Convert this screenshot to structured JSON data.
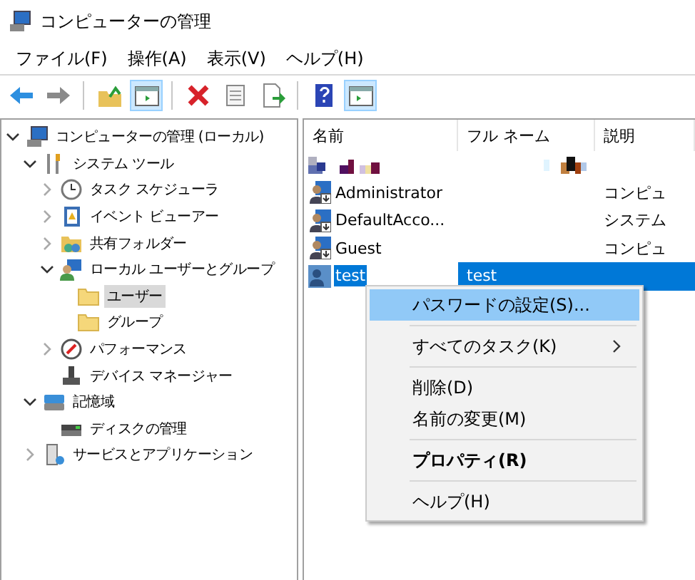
{
  "window": {
    "title": "コンピューターの管理"
  },
  "menu_bar": [
    "ファイル(F)",
    "操作(A)",
    "表示(V)",
    "ヘルプ(H)"
  ],
  "toolbar": [
    {
      "kind": "back",
      "pressed": false
    },
    {
      "kind": "forward",
      "pressed": false
    },
    {
      "kind": "separator"
    },
    {
      "kind": "up",
      "pressed": false
    },
    {
      "kind": "tree",
      "pressed": true
    },
    {
      "kind": "separator"
    },
    {
      "kind": "delete",
      "pressed": false
    },
    {
      "kind": "properties",
      "pressed": false
    },
    {
      "kind": "export",
      "pressed": false
    },
    {
      "kind": "separator"
    },
    {
      "kind": "help",
      "pressed": false
    },
    {
      "kind": "action",
      "pressed": true
    }
  ],
  "tree": [
    {
      "label": "コンピューターの管理 (ローカル)",
      "expanded": true,
      "selected": false,
      "children": [
        {
          "label": "システム ツール",
          "expanded": true,
          "selected": false,
          "children": [
            {
              "label": "タスク スケジューラ",
              "expanded": false,
              "selected": false
            },
            {
              "label": "イベント ビューアー",
              "expanded": false,
              "selected": false
            },
            {
              "label": "共有フォルダー",
              "expanded": false,
              "selected": false
            },
            {
              "label": "ローカル ユーザーとグループ",
              "expanded": true,
              "selected": false,
              "children": [
                {
                  "label": "ユーザー",
                  "selected": true
                },
                {
                  "label": "グループ",
                  "selected": false
                }
              ]
            },
            {
              "label": "パフォーマンス",
              "expanded": false,
              "selected": false
            },
            {
              "label": "デバイス マネージャー",
              "selected": false
            }
          ]
        },
        {
          "label": "記憶域",
          "expanded": true,
          "selected": false,
          "children": [
            {
              "label": "ディスクの管理",
              "selected": false
            }
          ]
        },
        {
          "label": "サービスとアプリケーション",
          "expanded": false,
          "selected": false
        }
      ]
    }
  ],
  "table": {
    "columns": [
      "名前",
      "フル ネーム",
      "説明"
    ],
    "rows": [
      {
        "kind": "redacted"
      },
      {
        "kind": "user",
        "name": "Administrator",
        "description": "コンピュ",
        "selected": false
      },
      {
        "kind": "user",
        "name": "DefaultAcco...",
        "description": "システム",
        "selected": false
      },
      {
        "kind": "user",
        "name": "Guest",
        "description": "コンピュ",
        "selected": false
      },
      {
        "kind": "user",
        "name": "test",
        "full_name": "test",
        "selected": true
      }
    ]
  },
  "context_menu": [
    {
      "kind": "item",
      "label": "パスワードの設定(S)...",
      "selected": true,
      "bold": false,
      "submenu": false
    },
    {
      "kind": "separator"
    },
    {
      "kind": "item",
      "label": "すべてのタスク(K)",
      "selected": false,
      "bold": false,
      "submenu": true
    },
    {
      "kind": "separator"
    },
    {
      "kind": "item",
      "label": "削除(D)",
      "selected": false,
      "bold": false,
      "submenu": false
    },
    {
      "kind": "item",
      "label": "名前の変更(M)",
      "selected": false,
      "bold": false,
      "submenu": false
    },
    {
      "kind": "separator"
    },
    {
      "kind": "item",
      "label": "プロパティ(R)",
      "selected": false,
      "bold": true,
      "submenu": false
    },
    {
      "kind": "separator"
    },
    {
      "kind": "item",
      "label": "ヘルプ(H)",
      "selected": false,
      "bold": false,
      "submenu": false
    }
  ]
}
